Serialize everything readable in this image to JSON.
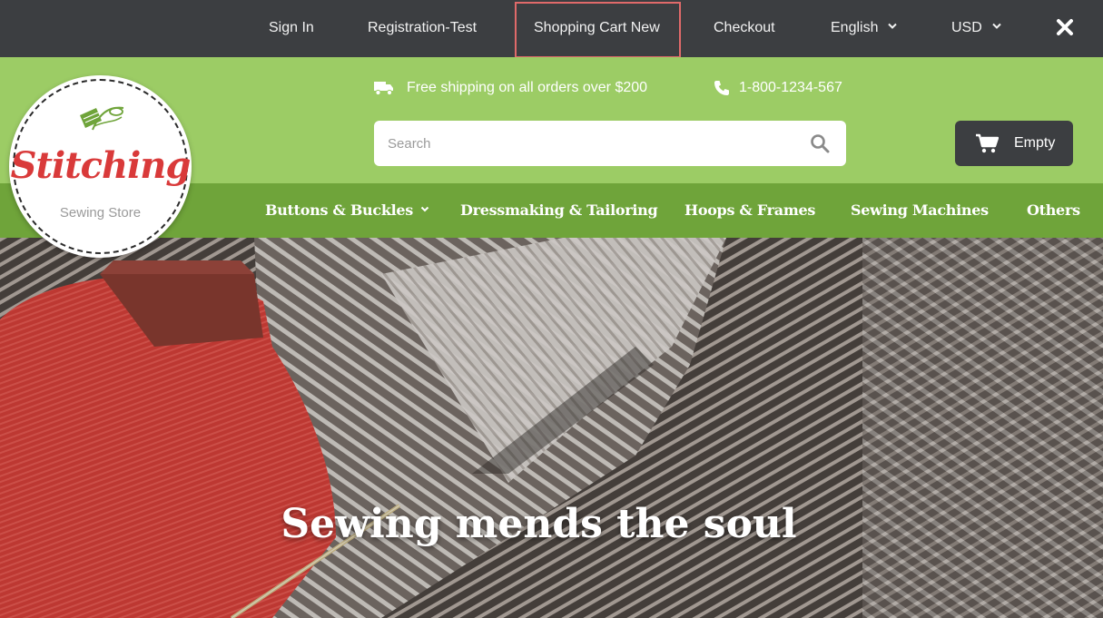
{
  "topbar": {
    "sign_in": "Sign In",
    "registration": "Registration-Test",
    "shopping_cart": "Shopping Cart New",
    "checkout": "Checkout",
    "language": "English",
    "currency": "USD",
    "close_icon": "close-icon",
    "highlight_color": "#e06a6a"
  },
  "header": {
    "shipping_text": "Free shipping on all orders over $200",
    "shipping_icon": "truck-icon",
    "phone": "1-800-1234-567",
    "phone_icon": "phone-icon",
    "search_placeholder": "Search",
    "search_icon": "search-icon",
    "cart_label": "Empty",
    "cart_icon": "cart-icon"
  },
  "logo": {
    "name": "Stitching",
    "subtitle": "Sewing Store"
  },
  "nav": {
    "items": [
      {
        "label": "Buttons & Buckles",
        "has_dropdown": true
      },
      {
        "label": "Dressmaking & Tailoring"
      },
      {
        "label": "Hoops & Frames"
      },
      {
        "label": "Sewing Machines"
      },
      {
        "label": "Others"
      }
    ]
  },
  "hero": {
    "tagline": "Sewing mends the soul"
  },
  "colors": {
    "topbar_bg": "#3c3e41",
    "header_green": "#9ccc65",
    "nav_green": "#6fa43a",
    "logo_red": "#d93a3a"
  }
}
